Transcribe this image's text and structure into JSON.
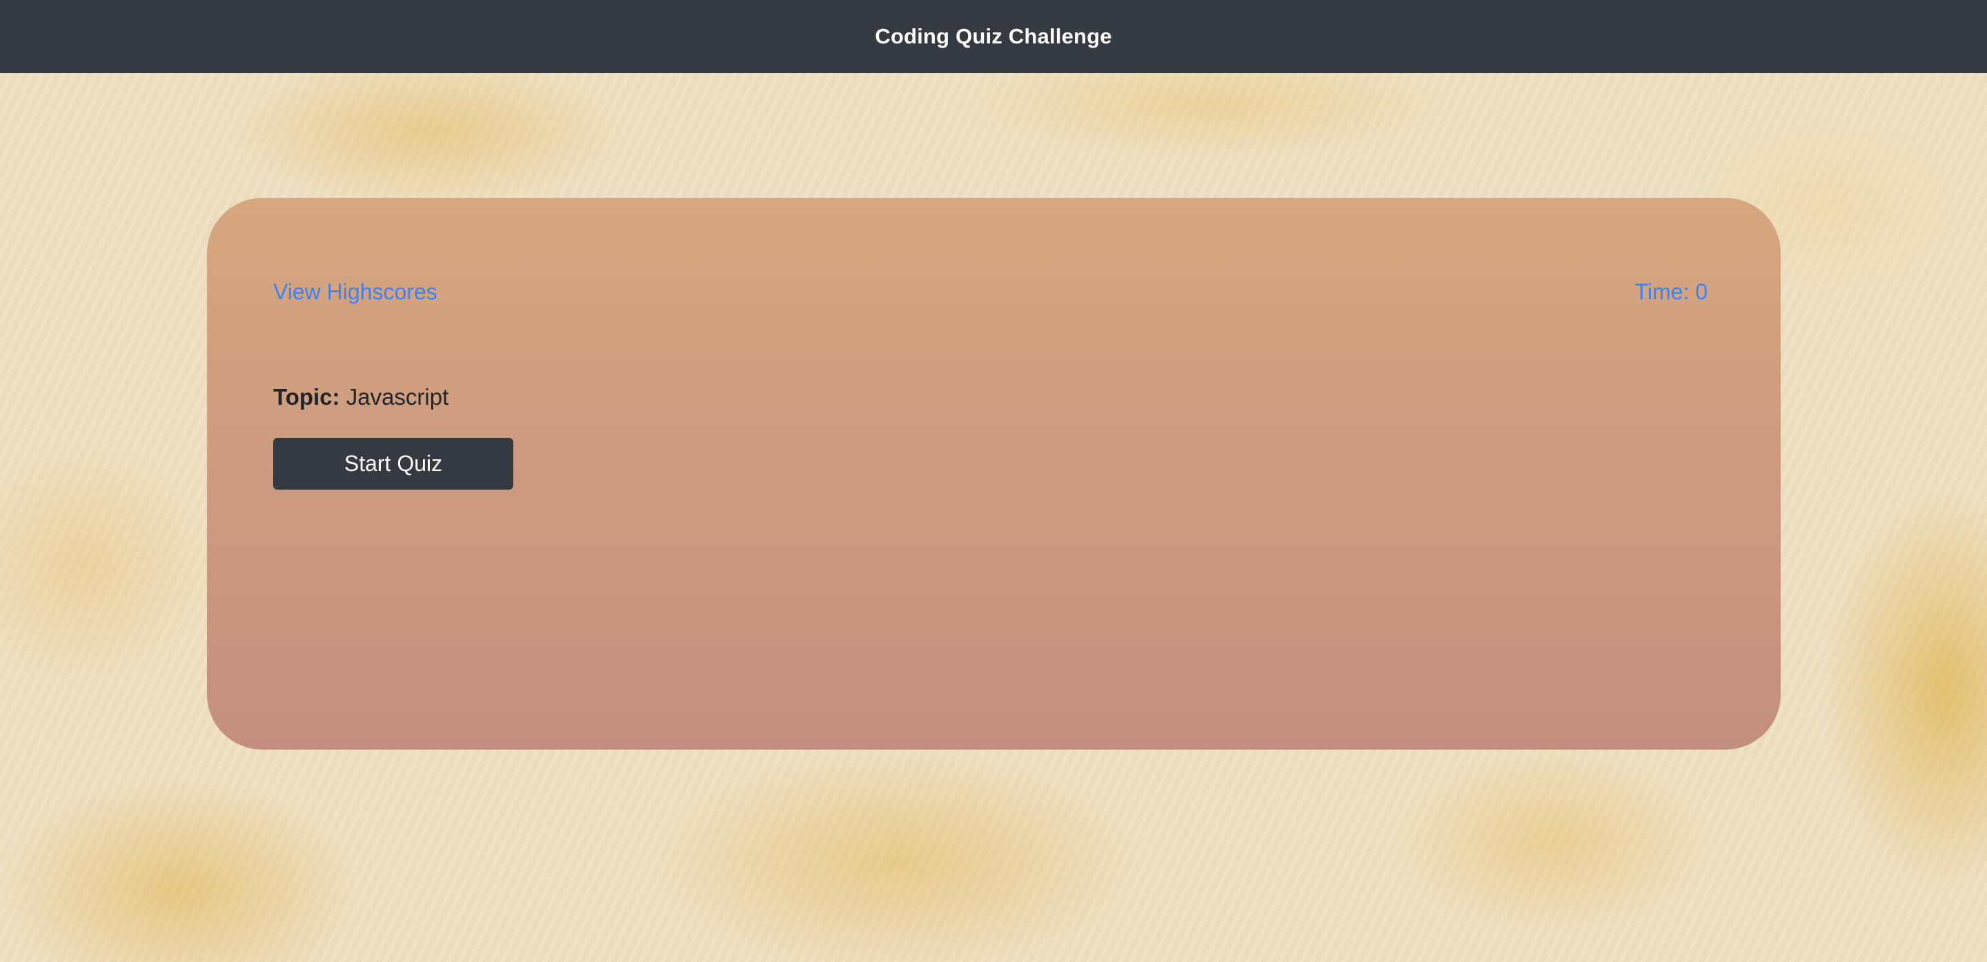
{
  "header": {
    "title": "Coding Quiz Challenge"
  },
  "quiz_card": {
    "highscores_link": "View Highscores",
    "timer": "Time: 0",
    "topic_label": "Topic:",
    "topic_value": "Javascript",
    "start_button": "Start Quiz"
  },
  "colors": {
    "header_bg": "#343a40",
    "link": "#3b82f6",
    "card_top": "#d6a67f",
    "card_bottom": "#c48f80",
    "button_bg": "#343a40"
  }
}
